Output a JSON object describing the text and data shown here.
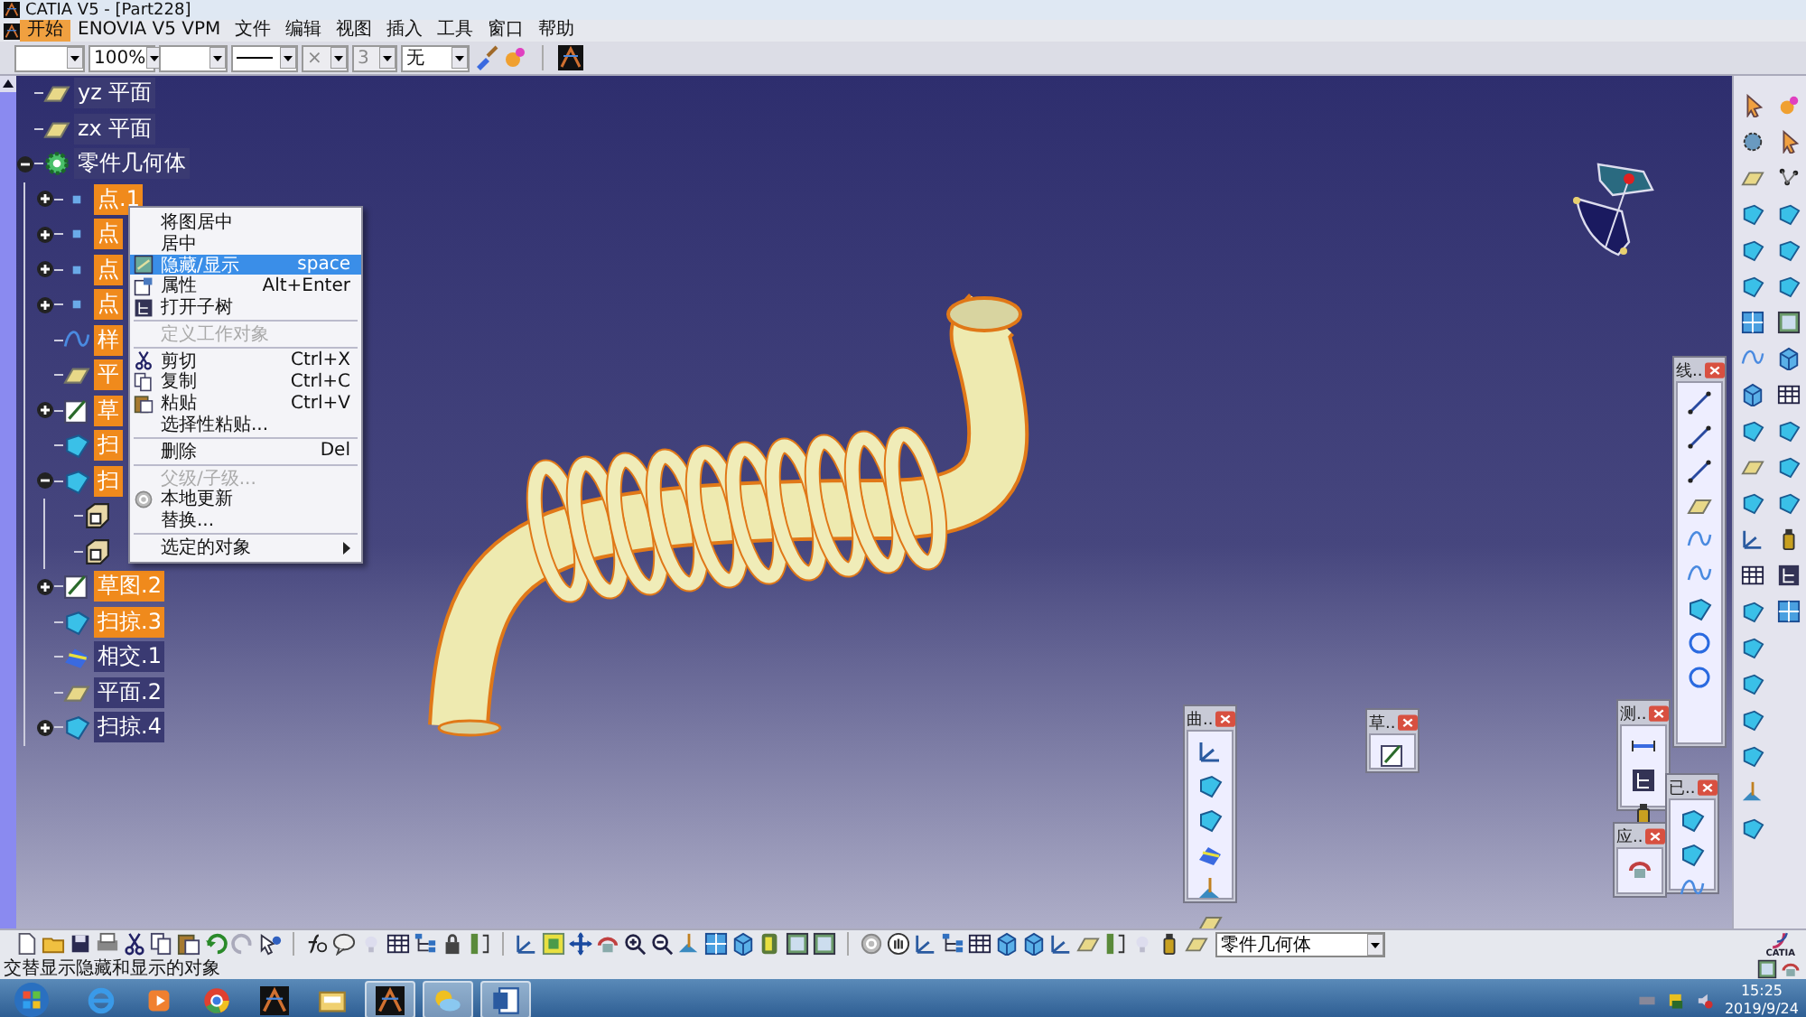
{
  "window": {
    "title": "CATIA V5 - [Part228]"
  },
  "menu": [
    {
      "label": "开始",
      "selected": true
    },
    {
      "label": "ENOVIA V5 VPM",
      "selected": false
    },
    {
      "label": "文件",
      "selected": false
    },
    {
      "label": "编辑",
      "selected": false
    },
    {
      "label": "视图",
      "selected": false
    },
    {
      "label": "插入",
      "selected": false
    },
    {
      "label": "工具",
      "selected": false
    },
    {
      "label": "窗口",
      "selected": false
    },
    {
      "label": "帮助",
      "selected": false
    }
  ],
  "toolbar_fields": [
    {
      "kind": "blank",
      "disabled": false
    },
    {
      "kind": "text",
      "value": "100%",
      "disabled": false
    },
    {
      "kind": "blank",
      "disabled": false
    },
    {
      "kind": "line",
      "disabled": false
    },
    {
      "kind": "text",
      "value": "×",
      "disabled": true
    },
    {
      "kind": "text",
      "value": "3",
      "disabled": true
    },
    {
      "kind": "text",
      "value": "无",
      "disabled": false
    }
  ],
  "tree": [
    {
      "label": "yz 平面",
      "kind": "plane",
      "highlighted": false
    },
    {
      "label": "zx 平面",
      "kind": "plane",
      "highlighted": false
    },
    {
      "label": "零件几何体",
      "kind": "body",
      "highlighted": false,
      "expanded": true,
      "children": [
        {
          "label": "点.1",
          "kind": "point",
          "highlighted": true,
          "expanded": false
        },
        {
          "label": "点",
          "kind": "point",
          "highlighted": true,
          "expanded": false
        },
        {
          "label": "点",
          "kind": "point",
          "highlighted": true,
          "expanded": false
        },
        {
          "label": "点",
          "kind": "point",
          "highlighted": true,
          "expanded": false
        },
        {
          "label": "样",
          "kind": "spline",
          "highlighted": true
        },
        {
          "label": "平",
          "kind": "plane",
          "highlighted": true
        },
        {
          "label": "草",
          "kind": "sketch",
          "highlighted": true,
          "expanded": false
        },
        {
          "label": "扫",
          "kind": "sweep",
          "highlighted": true
        },
        {
          "label": "扫",
          "kind": "sweep",
          "highlighted": true,
          "expanded": true,
          "children": [
            {
              "kind": "box"
            },
            {
              "kind": "box"
            }
          ]
        },
        {
          "label": "草图.2",
          "kind": "sketch",
          "highlighted": true,
          "expanded": false
        },
        {
          "label": "扫掠.3",
          "kind": "sweep",
          "highlighted": true
        },
        {
          "label": "相交.1",
          "kind": "intersect",
          "highlighted": false
        },
        {
          "label": "平面.2",
          "kind": "plane",
          "highlighted": false
        },
        {
          "label": "扫掠.4",
          "kind": "sweep",
          "highlighted": false,
          "expanded": false
        }
      ]
    }
  ],
  "context_menu": [
    {
      "kind": "item",
      "label": "将图居中",
      "disabled": false,
      "selected": false
    },
    {
      "kind": "item",
      "label": "居中",
      "disabled": false,
      "selected": false
    },
    {
      "kind": "item",
      "label": "隐藏/显示",
      "shortcut": "space",
      "disabled": false,
      "selected": true
    },
    {
      "kind": "item",
      "label": "属性",
      "shortcut": "Alt+Enter",
      "disabled": false,
      "selected": false
    },
    {
      "kind": "item",
      "label": "打开子树",
      "disabled": false,
      "selected": false
    },
    {
      "kind": "separator"
    },
    {
      "kind": "item",
      "label": "定义工作对象",
      "disabled": true,
      "selected": false
    },
    {
      "kind": "separator"
    },
    {
      "kind": "item",
      "label": "剪切",
      "shortcut": "Ctrl+X",
      "disabled": false,
      "selected": false
    },
    {
      "kind": "item",
      "label": "复制",
      "shortcut": "Ctrl+C",
      "disabled": false,
      "selected": false
    },
    {
      "kind": "item",
      "label": "粘贴",
      "shortcut": "Ctrl+V",
      "disabled": false,
      "selected": false
    },
    {
      "kind": "item",
      "label": "选择性粘贴...",
      "disabled": false,
      "selected": false
    },
    {
      "kind": "separator"
    },
    {
      "kind": "item",
      "label": "删除",
      "shortcut": "Del",
      "disabled": false,
      "selected": false
    },
    {
      "kind": "separator"
    },
    {
      "kind": "item",
      "label": "父级/子级...",
      "disabled": true,
      "selected": false
    },
    {
      "kind": "item",
      "label": "本地更新",
      "disabled": false,
      "selected": false
    },
    {
      "kind": "item",
      "label": "替换...",
      "disabled": false,
      "selected": false
    },
    {
      "kind": "separator"
    },
    {
      "kind": "submenu",
      "label": "选定的对象",
      "disabled": false,
      "selected": false
    }
  ],
  "floating_toolbars": [
    {
      "title": "线.."
    },
    {
      "title": "曲.."
    },
    {
      "title": "草.."
    },
    {
      "title": "测.."
    },
    {
      "title": "已.."
    },
    {
      "title": "应.."
    }
  ],
  "bottom_toolbar": {
    "current_body": "零件几何体"
  },
  "logo": "CATIA",
  "status_bar": {
    "text": "交替显示隐藏和显示的对象"
  },
  "taskbar": {
    "apps": [
      {
        "selected": false
      },
      {
        "selected": false
      },
      {
        "selected": false
      },
      {
        "selected": false
      },
      {
        "selected": false
      },
      {
        "selected": true
      },
      {
        "selected": true
      },
      {
        "selected": true
      }
    ],
    "time": "15:25",
    "date": "2019/9/24"
  }
}
